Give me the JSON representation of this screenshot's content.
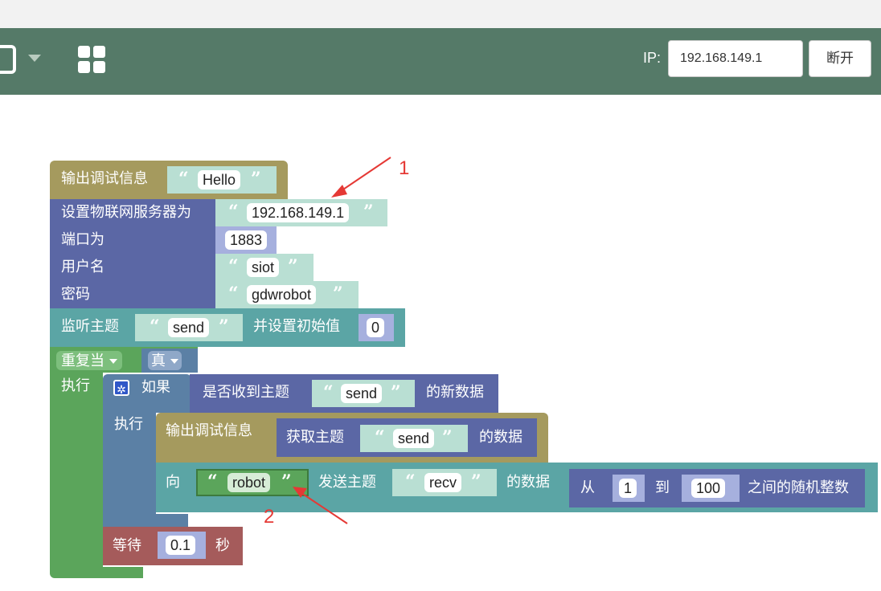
{
  "toolbar": {
    "ip_label": "IP:",
    "ip_value": "192.168.149.1",
    "disconnect_label": "断开",
    "file_icon": "save-icon",
    "apps_icon": "grid-icon"
  },
  "blocks": {
    "debug1": {
      "label": "输出调试信息",
      "value": "Hello"
    },
    "iot": {
      "server_label": "设置物联网服务器为",
      "server_value": "192.168.149.1",
      "port_label": "端口为",
      "port_value": "1883",
      "user_label": "用户名",
      "user_value": "siot",
      "pass_label": "密码",
      "pass_value": "gdwrobot"
    },
    "listen": {
      "label": "监听主题",
      "topic": "send",
      "init_label": "并设置初始值",
      "init_value": "0"
    },
    "repeat": {
      "label": "重复当",
      "cond": "真",
      "do_label": "执行"
    },
    "if": {
      "label": "如果",
      "check_label": "是否收到主题",
      "topic": "send",
      "suffix": "的新数据",
      "do_label": "执行"
    },
    "debug2": {
      "label": "输出调试信息",
      "get_label": "获取主题",
      "topic": "send",
      "suffix": "的数据"
    },
    "send": {
      "to_label": "向",
      "target": "robot",
      "send_label": "发送主题",
      "topic": "recv",
      "data_label": "的数据",
      "from_label": "从",
      "min": "1",
      "to": "到",
      "max": "100",
      "rand_label": "之间的随机整数"
    },
    "wait": {
      "label": "等待",
      "value": "0.1",
      "unit": "秒"
    }
  },
  "annotations": {
    "a1": "1",
    "a2": "2"
  },
  "colors": {
    "toolbar": "#557a68",
    "debug_block": "#a59a5e",
    "iot_block": "#5b67a5",
    "listen_block": "#5ba5a5",
    "loop_block": "#5ba55b",
    "logic_block": "#5b80a5",
    "wait_block": "#a55b5b",
    "string_slot": "#b9dfd3",
    "annotation": "#e53935"
  }
}
